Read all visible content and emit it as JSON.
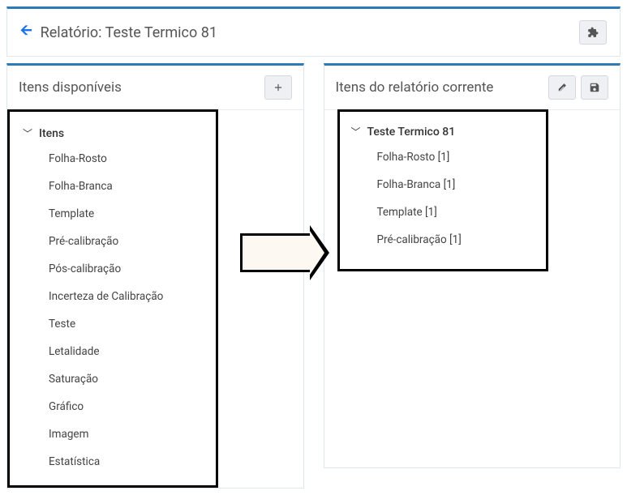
{
  "header": {
    "title": "Relatório: Teste Termico 81"
  },
  "panels": {
    "available": {
      "title": "Itens disponíveis",
      "root_label": "Itens",
      "items": [
        "Folha-Rosto",
        "Folha-Branca",
        "Template",
        "Pré-calibração",
        "Pós-calibração",
        "Incerteza de Calibração",
        "Teste",
        "Letalidade",
        "Saturação",
        "Gráfico",
        "Imagem",
        "Estatística"
      ]
    },
    "current": {
      "title": "Itens do relatório corrente",
      "root_label": "Teste Termico 81",
      "items": [
        "Folha-Rosto [1]",
        "Folha-Branca [1]",
        "Template [1]",
        "Pré-calibração [1]"
      ]
    }
  }
}
